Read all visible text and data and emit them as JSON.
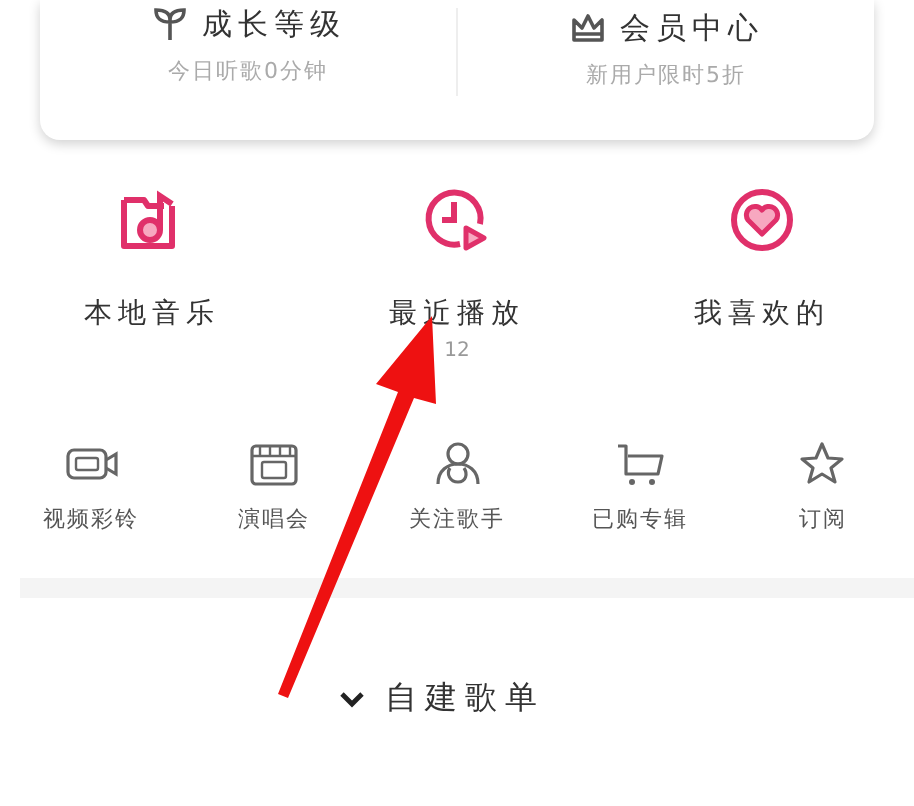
{
  "card": {
    "items": [
      {
        "title": "成长等级",
        "subtitle": "今日听歌0分钟"
      },
      {
        "title": "会员中心",
        "subtitle": "新用户限时5折"
      }
    ]
  },
  "quick_links": [
    {
      "label": "本地音乐"
    },
    {
      "label": "最近播放",
      "count": "12"
    },
    {
      "label": "我喜欢的"
    }
  ],
  "features": [
    {
      "label": "视频彩铃"
    },
    {
      "label": "演唱会"
    },
    {
      "label": "关注歌手"
    },
    {
      "label": "已购专辑"
    },
    {
      "label": "订阅"
    }
  ],
  "playlist_section": {
    "title": "自建歌单",
    "expanded": true
  }
}
